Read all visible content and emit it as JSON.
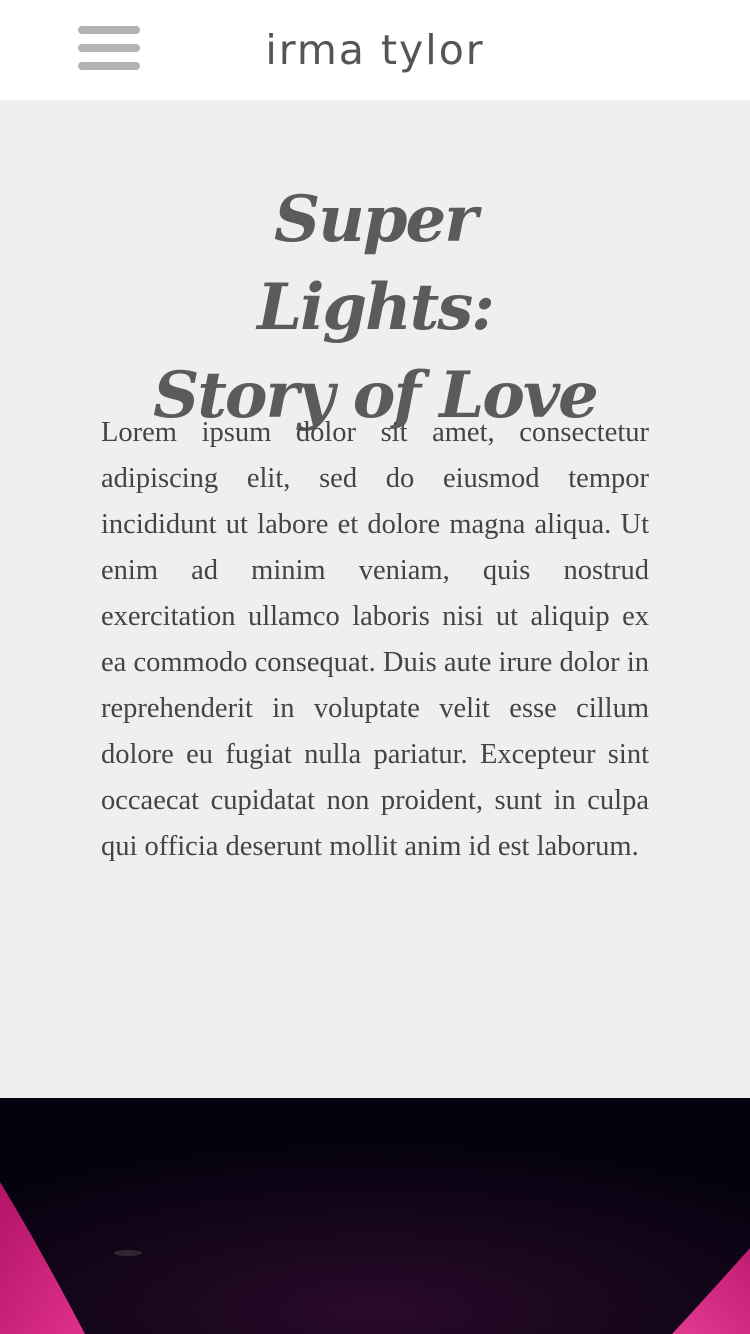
{
  "header": {
    "site_title": "irma tylor",
    "menu_icon": "hamburger-menu-icon"
  },
  "article": {
    "title_line1": "Super Lights:",
    "title_line2": "Story of Love",
    "body": "Lorem ipsum dolor sit amet, consectetur adipiscing elit, sed do eiusmod tempor incididunt ut labore et dolore magna aliqua. Ut enim ad minim veniam, quis nostrud exercitation ullamco laboris nisi ut aliquip ex ea commodo consequat. Duis aute irure dolor in reprehenderit in voluptate velit esse cillum dolore eu fugiat nulla pariatur. Excepteur sint occaecat cupidatat non proident, sunt in culpa qui officia deserunt mollit anim id est laborum."
  },
  "colors": {
    "header_bg": "#ffffff",
    "page_bg": "#efefef",
    "text": "#444444",
    "hero_bg": "#05020f",
    "hero_accent": "#d6237e"
  }
}
